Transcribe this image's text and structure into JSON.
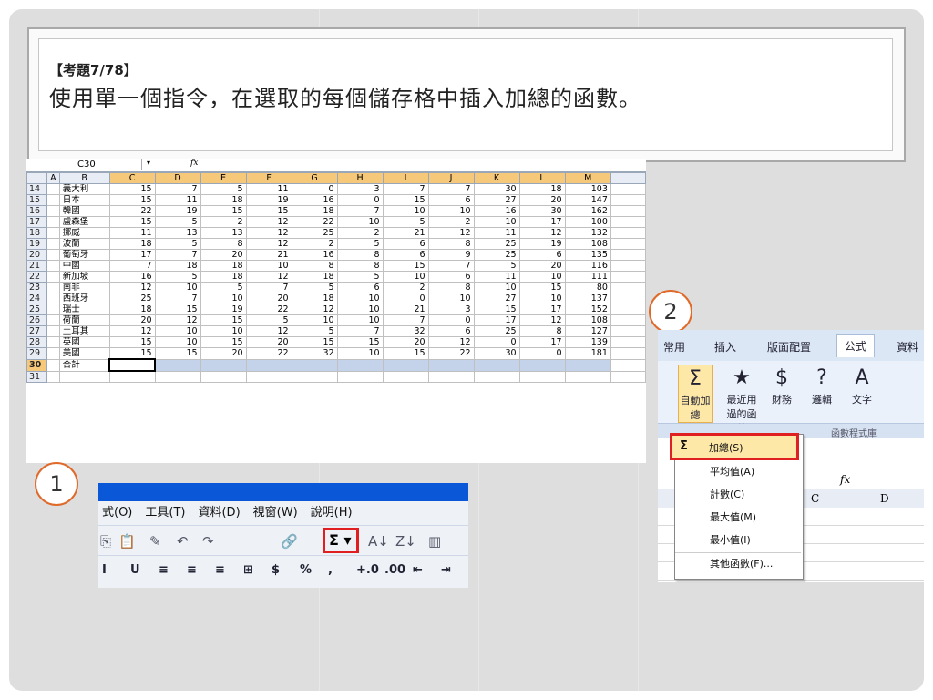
{
  "question": {
    "title": "【考題7/78】",
    "text": "使用單一個指令，在選取的每個儲存格中插入加總的函數。"
  },
  "callouts": {
    "one": "1",
    "two": "2"
  },
  "spreadsheet": {
    "name_box": "C30",
    "name_box_arrow": "▾",
    "fx_label": "fx",
    "columns": [
      "A",
      "B",
      "C",
      "D",
      "E",
      "F",
      "G",
      "H",
      "I",
      "J",
      "K",
      "L",
      "M"
    ],
    "rows": [
      {
        "row": "14",
        "name": "義大利",
        "vals": [
          "15",
          "7",
          "5",
          "11",
          "0",
          "3",
          "7",
          "7",
          "30",
          "18",
          "103"
        ]
      },
      {
        "row": "15",
        "name": "日本",
        "vals": [
          "15",
          "11",
          "18",
          "19",
          "16",
          "0",
          "15",
          "6",
          "27",
          "20",
          "147"
        ]
      },
      {
        "row": "16",
        "name": "韓國",
        "vals": [
          "22",
          "19",
          "15",
          "15",
          "18",
          "7",
          "10",
          "10",
          "16",
          "30",
          "162"
        ]
      },
      {
        "row": "17",
        "name": "盧森堡",
        "vals": [
          "15",
          "5",
          "2",
          "12",
          "22",
          "10",
          "5",
          "2",
          "10",
          "17",
          "100"
        ]
      },
      {
        "row": "18",
        "name": "挪威",
        "vals": [
          "11",
          "13",
          "13",
          "12",
          "25",
          "2",
          "21",
          "12",
          "11",
          "12",
          "132"
        ]
      },
      {
        "row": "19",
        "name": "波蘭",
        "vals": [
          "18",
          "5",
          "8",
          "12",
          "2",
          "5",
          "6",
          "8",
          "25",
          "19",
          "108"
        ]
      },
      {
        "row": "20",
        "name": "葡萄牙",
        "vals": [
          "17",
          "7",
          "20",
          "21",
          "16",
          "8",
          "6",
          "9",
          "25",
          "6",
          "135"
        ]
      },
      {
        "row": "21",
        "name": "中國",
        "vals": [
          "7",
          "18",
          "18",
          "10",
          "8",
          "8",
          "15",
          "7",
          "5",
          "20",
          "116"
        ]
      },
      {
        "row": "22",
        "name": "新加坡",
        "vals": [
          "16",
          "5",
          "18",
          "12",
          "18",
          "5",
          "10",
          "6",
          "11",
          "10",
          "111"
        ]
      },
      {
        "row": "23",
        "name": "南非",
        "vals": [
          "12",
          "10",
          "5",
          "7",
          "5",
          "6",
          "2",
          "8",
          "10",
          "15",
          "80"
        ]
      },
      {
        "row": "24",
        "name": "西班牙",
        "vals": [
          "25",
          "7",
          "10",
          "20",
          "18",
          "10",
          "0",
          "10",
          "27",
          "10",
          "137"
        ]
      },
      {
        "row": "25",
        "name": "瑞士",
        "vals": [
          "18",
          "15",
          "19",
          "22",
          "12",
          "10",
          "21",
          "3",
          "15",
          "17",
          "152"
        ]
      },
      {
        "row": "26",
        "name": "荷蘭",
        "vals": [
          "20",
          "12",
          "15",
          "5",
          "10",
          "10",
          "7",
          "0",
          "17",
          "12",
          "108"
        ]
      },
      {
        "row": "27",
        "name": "土耳其",
        "vals": [
          "12",
          "10",
          "10",
          "12",
          "5",
          "7",
          "32",
          "6",
          "25",
          "8",
          "127"
        ]
      },
      {
        "row": "28",
        "name": "英國",
        "vals": [
          "15",
          "10",
          "15",
          "20",
          "15",
          "15",
          "20",
          "12",
          "0",
          "17",
          "139"
        ]
      },
      {
        "row": "29",
        "name": "美國",
        "vals": [
          "15",
          "15",
          "20",
          "22",
          "32",
          "10",
          "15",
          "22",
          "30",
          "0",
          "181"
        ]
      }
    ],
    "sum_row": {
      "row": "30",
      "name": "合計"
    },
    "last_row": "31"
  },
  "toolbar": {
    "menu": [
      "式(O)",
      "工具(T)",
      "資料(D)",
      "視窗(W)",
      "說明(H)"
    ],
    "sigma": "Σ ▾",
    "row2": [
      "I",
      "U",
      "≡",
      "≡",
      "≡",
      "⊞",
      "$",
      "%",
      ",",
      "+.0",
      ".00",
      "⇤",
      "⇥"
    ]
  },
  "ribbon": {
    "tabs": [
      "常用",
      "插入",
      "版面配置",
      "公式",
      "資料"
    ],
    "active_tab": "公式",
    "buttons": [
      {
        "label": "自動加總",
        "icon": "Σ"
      },
      {
        "label": "最近用過的函數",
        "icon": "★"
      },
      {
        "label": "財務",
        "icon": "$"
      },
      {
        "label": "邏輯",
        "icon": "?"
      },
      {
        "label": "文字",
        "icon": "A"
      }
    ],
    "group_label": "函數程式庫",
    "cell_col_c": "C",
    "cell_col_d": "D",
    "fx_label": "fx"
  },
  "dropdown": {
    "items": [
      "加總(S)",
      "平均值(A)",
      "計數(C)",
      "最大值(M)",
      "最小值(I)",
      "其他函數(F)..."
    ],
    "first_icon": "Σ"
  },
  "colors": {
    "accent_red": "#e02020",
    "callout_orange": "#e06a2a",
    "xp_blue": "#0a57d8"
  }
}
